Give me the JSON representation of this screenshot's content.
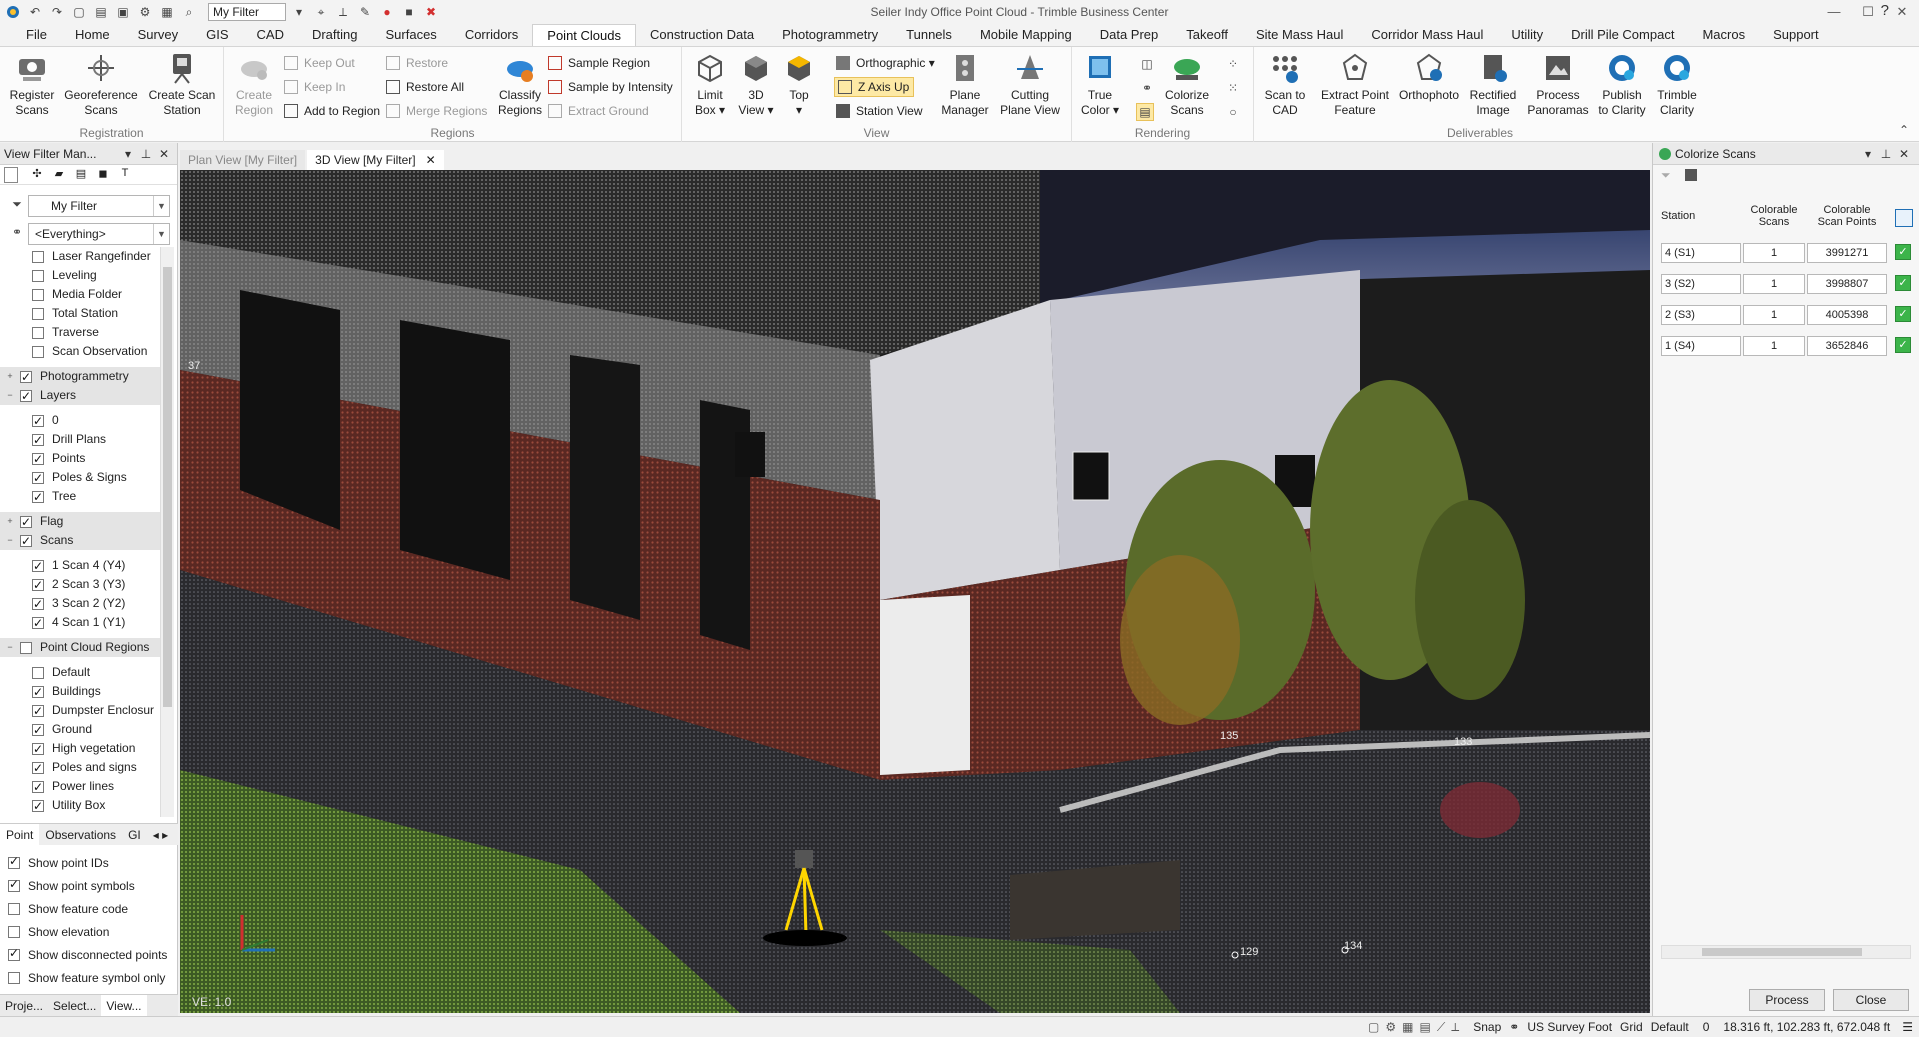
{
  "window": {
    "title": "Seiler Indy Office Point Cloud - Trimble Business Center",
    "filter_value": "My Filter"
  },
  "menu": {
    "tabs": [
      "File",
      "Home",
      "Survey",
      "GIS",
      "CAD",
      "Drafting",
      "Surfaces",
      "Corridors",
      "Point Clouds",
      "Construction Data",
      "Photogrammetry",
      "Tunnels",
      "Mobile Mapping",
      "Data Prep",
      "Takeoff",
      "Site Mass Haul",
      "Corridor Mass Haul",
      "Utility",
      "Drill Pile Compact",
      "Macros",
      "Support"
    ],
    "active": "Point Clouds",
    "help": "?"
  },
  "ribbon": {
    "registration": {
      "label": "Registration",
      "register_scans": "Register\nScans",
      "georeference_scans": "Georeference\nScans",
      "create_scan_station": "Create Scan\nStation"
    },
    "regions": {
      "label": "Regions",
      "create_region": "Create\nRegion",
      "keep_out": "Keep Out",
      "keep_in": "Keep In",
      "add_to_region": "Add to Region",
      "restore": "Restore",
      "restore_all": "Restore All",
      "merge_regions": "Merge Regions",
      "classify_regions": "Classify\nRegions",
      "sample_region": "Sample Region",
      "sample_by_intensity": "Sample by Intensity",
      "extract_ground": "Extract Ground"
    },
    "view": {
      "label": "View",
      "limit_box": "Limit\nBox ▾",
      "view_3d": "3D\nView ▾",
      "top": "Top\n▾",
      "orthographic": "Orthographic ▾",
      "z_axis_up": "Z Axis Up",
      "station_view": "Station View",
      "plane_manager": "Plane\nManager",
      "cutting_plane_view": "Cutting\nPlane View"
    },
    "rendering": {
      "label": "Rendering",
      "true_color": "True\nColor ▾",
      "colorize_scans": "Colorize\nScans"
    },
    "deliverables": {
      "label": "Deliverables",
      "scan_to_cad": "Scan to\nCAD",
      "extract_point_feature": "Extract Point\nFeature",
      "orthophoto": "Orthophoto",
      "rectified_image": "Rectified\nImage",
      "process_panoramas": "Process\nPanoramas",
      "publish_to_clarity": "Publish\nto Clarity",
      "trimble_clarity": "Trimble\nClarity"
    }
  },
  "left_panel": {
    "title": "View Filter Man...",
    "filter_combo": "My Filter",
    "everything_combo": "<Everything>",
    "tree": [
      {
        "label": "Laser Rangefinder",
        "checked": false,
        "group": false,
        "expand": "",
        "indent": 1
      },
      {
        "label": "Leveling",
        "checked": false,
        "group": false,
        "expand": "",
        "indent": 1
      },
      {
        "label": "Media Folder",
        "checked": false,
        "group": false,
        "expand": "",
        "indent": 1
      },
      {
        "label": "Total Station",
        "checked": false,
        "group": false,
        "expand": "",
        "indent": 1
      },
      {
        "label": "Traverse",
        "checked": false,
        "group": false,
        "expand": "",
        "indent": 1
      },
      {
        "label": "Scan Observation",
        "checked": false,
        "group": false,
        "expand": "",
        "indent": 1
      },
      {
        "label": "",
        "spacer": true
      },
      {
        "label": "Photogrammetry",
        "checked": true,
        "group": true,
        "expand": "+",
        "indent": 0
      },
      {
        "label": "Layers",
        "checked": true,
        "group": true,
        "expand": "−",
        "indent": 0
      },
      {
        "label": "",
        "spacer": true
      },
      {
        "label": "0",
        "checked": true,
        "group": false,
        "expand": "",
        "indent": 1
      },
      {
        "label": "Drill Plans",
        "checked": true,
        "group": false,
        "expand": "",
        "indent": 1
      },
      {
        "label": "Points",
        "checked": true,
        "group": false,
        "expand": "",
        "indent": 1
      },
      {
        "label": "Poles & Signs",
        "checked": true,
        "group": false,
        "expand": "",
        "indent": 1
      },
      {
        "label": "Tree",
        "checked": true,
        "group": false,
        "expand": "",
        "indent": 1
      },
      {
        "label": "",
        "spacer": true
      },
      {
        "label": "Flag",
        "checked": true,
        "group": true,
        "expand": "+",
        "indent": 0
      },
      {
        "label": "Scans",
        "checked": true,
        "group": true,
        "expand": "−",
        "indent": 0
      },
      {
        "label": "",
        "spacer": true
      },
      {
        "label": "1 Scan 4 (Y4)",
        "checked": true,
        "group": false,
        "expand": "",
        "indent": 1
      },
      {
        "label": "2 Scan 3 (Y3)",
        "checked": true,
        "group": false,
        "expand": "",
        "indent": 1
      },
      {
        "label": "3 Scan 2 (Y2)",
        "checked": true,
        "group": false,
        "expand": "",
        "indent": 1
      },
      {
        "label": "4 Scan 1 (Y1)",
        "checked": true,
        "group": false,
        "expand": "",
        "indent": 1
      },
      {
        "label": "",
        "spacer": true
      },
      {
        "label": "Point Cloud Regions",
        "checked": false,
        "group": true,
        "expand": "−",
        "indent": 0
      },
      {
        "label": "",
        "spacer": true
      },
      {
        "label": "Default",
        "checked": false,
        "group": false,
        "expand": "",
        "indent": 1
      },
      {
        "label": "Buildings",
        "checked": true,
        "group": false,
        "expand": "",
        "indent": 1
      },
      {
        "label": "Dumpster Enclosur",
        "checked": true,
        "group": false,
        "expand": "",
        "indent": 1
      },
      {
        "label": "Ground",
        "checked": true,
        "group": false,
        "expand": "",
        "indent": 1
      },
      {
        "label": "High vegetation",
        "checked": true,
        "group": false,
        "expand": "",
        "indent": 1
      },
      {
        "label": "Poles and signs",
        "checked": true,
        "group": false,
        "expand": "",
        "indent": 1
      },
      {
        "label": "Power lines",
        "checked": true,
        "group": false,
        "expand": "",
        "indent": 1
      },
      {
        "label": "Utility Box",
        "checked": true,
        "group": false,
        "expand": "",
        "indent": 1
      }
    ],
    "option_tabs": [
      "Point",
      "Observations",
      "GI"
    ],
    "options": [
      {
        "label": "Show point IDs",
        "checked": true
      },
      {
        "label": "Show point symbols",
        "checked": true
      },
      {
        "label": "Show feature code",
        "checked": false
      },
      {
        "label": "Show elevation",
        "checked": false
      },
      {
        "label": "Show disconnected points",
        "checked": true
      },
      {
        "label": "Show feature symbol only",
        "checked": false
      }
    ],
    "bottom_tabs": [
      "Proje...",
      "Select...",
      "View..."
    ]
  },
  "doc_tabs": [
    {
      "label": "Plan View [My Filter]",
      "active": false
    },
    {
      "label": "3D View [My Filter]",
      "active": true
    }
  ],
  "view3d": {
    "ve_label": "VE: 1.0",
    "point_labels": [
      "134",
      "133",
      "129",
      "135",
      "37"
    ]
  },
  "right_panel": {
    "title": "Colorize Scans",
    "headers": {
      "station": "Station",
      "colorable_scans": "Colorable\nScans",
      "colorable_points": "Colorable\nScan Points"
    },
    "rows": [
      {
        "station": "4 (S1)",
        "scans": "1",
        "points": "3991271"
      },
      {
        "station": "3 (S2)",
        "scans": "1",
        "points": "3998807"
      },
      {
        "station": "2 (S3)",
        "scans": "1",
        "points": "4005398"
      },
      {
        "station": "1 (S4)",
        "scans": "1",
        "points": "3652846"
      }
    ],
    "process_label": "Process",
    "close_label": "Close"
  },
  "status": {
    "snap": "Snap",
    "system": "US Survey Foot",
    "grid": "Grid",
    "default": "Default",
    "zero": "0",
    "coords": "18.316 ft, 102.283 ft, 672.048 ft"
  },
  "colors": {
    "accent": "#1f6fb5",
    "check_green": "#3cb44a",
    "highlight": "#fde9a5"
  }
}
